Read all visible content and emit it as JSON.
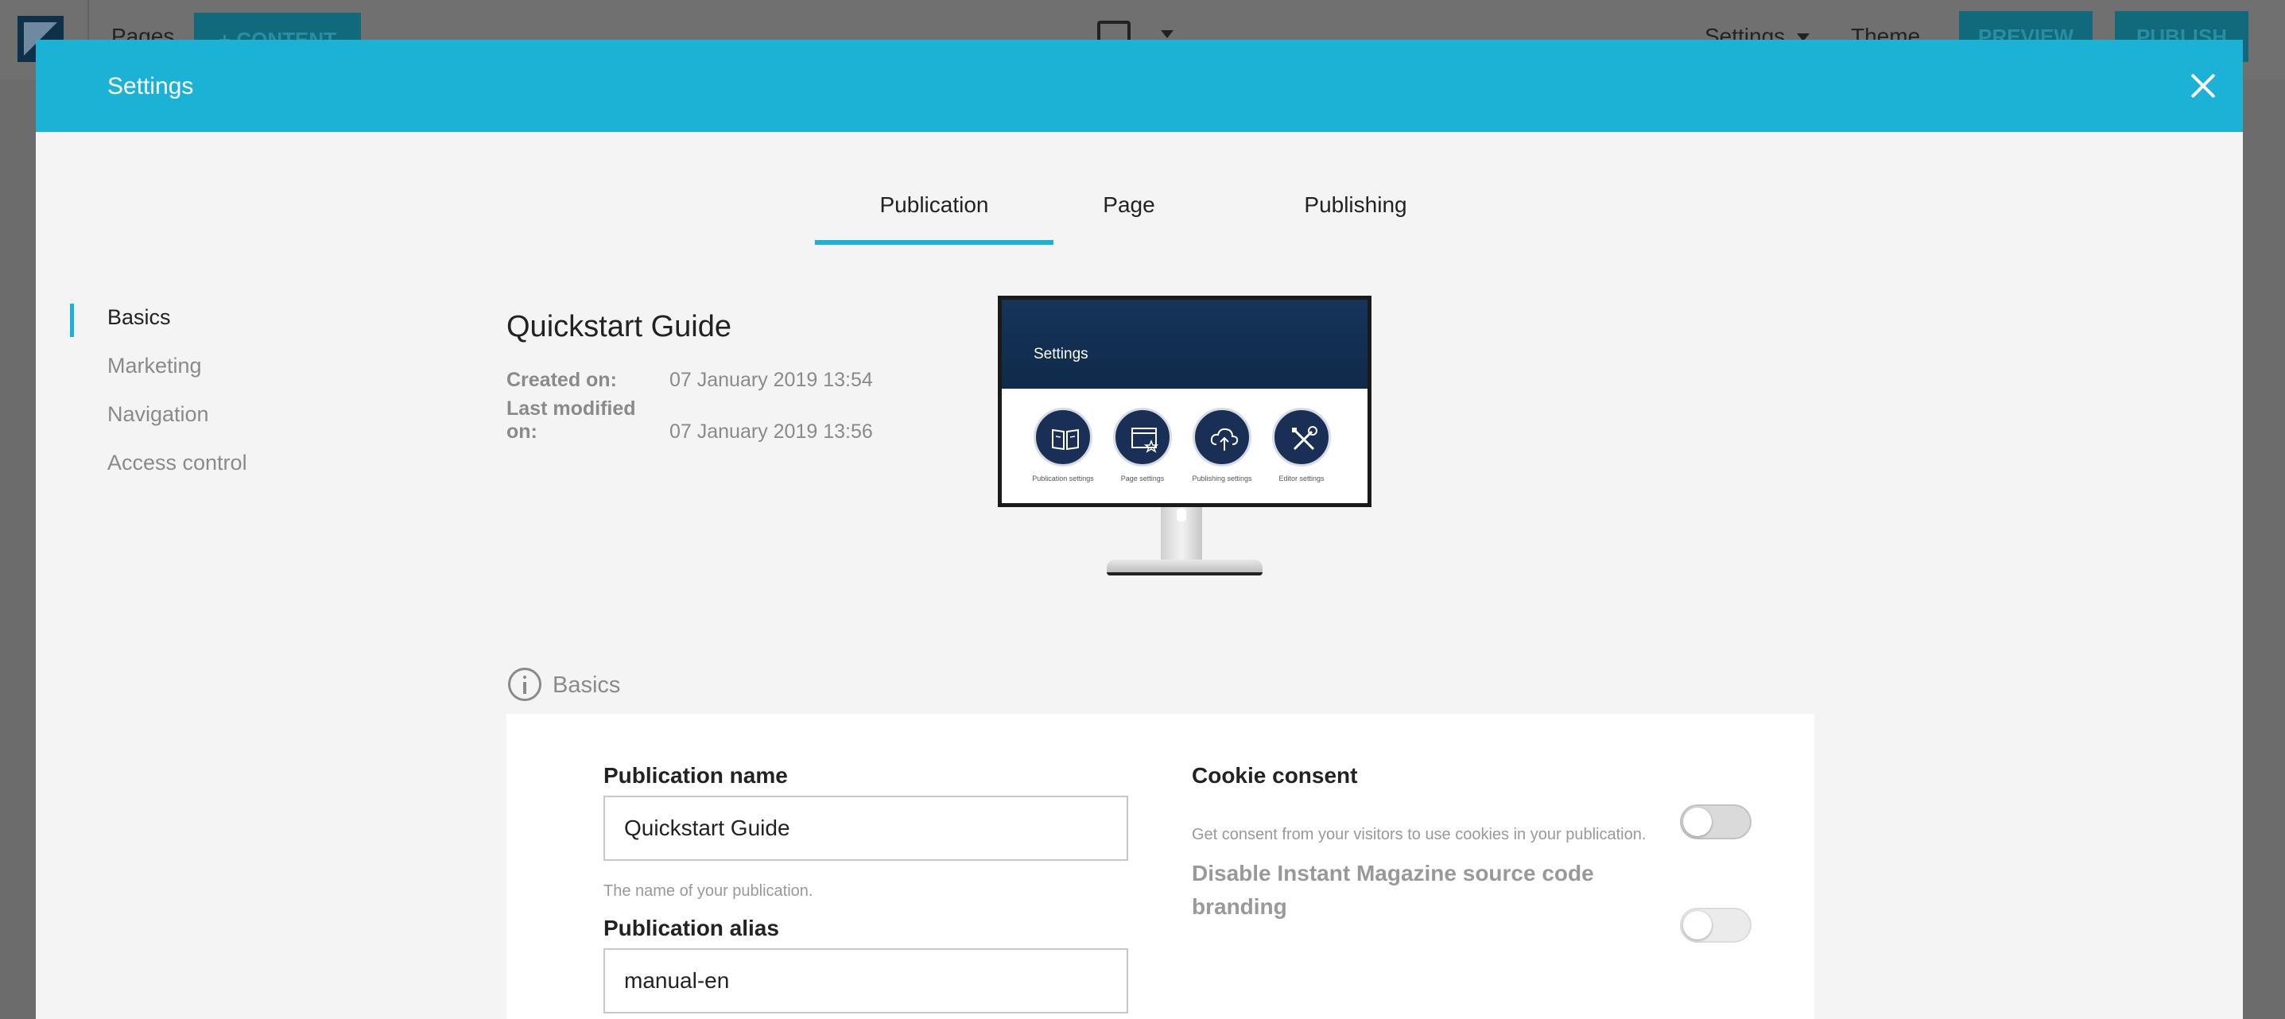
{
  "app": {
    "pages_label": "Pages",
    "content_button": "+ CONTENT",
    "settings_menu": "Settings",
    "theme_label": "Theme",
    "preview_button": "PREVIEW",
    "publish_button": "PUBLISH"
  },
  "modal": {
    "title": "Settings",
    "tabs": [
      {
        "label": "Publication",
        "active": true
      },
      {
        "label": "Page",
        "active": false
      },
      {
        "label": "Publishing",
        "active": false
      }
    ],
    "sidebar": [
      {
        "label": "Basics",
        "active": true
      },
      {
        "label": "Marketing",
        "active": false
      },
      {
        "label": "Navigation",
        "active": false
      },
      {
        "label": "Access control",
        "active": false
      }
    ],
    "publication": {
      "name": "Quickstart Guide",
      "created_label": "Created on:",
      "created_value": "07 January 2019 13:54",
      "modified_label": "Last modified on:",
      "modified_value": "07 January 2019 13:56"
    },
    "illustration": {
      "screen_title": "Settings",
      "items": [
        {
          "caption": "Publication settings",
          "icon": "book-icon"
        },
        {
          "caption": "Page settings",
          "icon": "page-star-icon"
        },
        {
          "caption": "Publishing settings",
          "icon": "cloud-upload-icon"
        },
        {
          "caption": "Editor settings",
          "icon": "tools-icon"
        }
      ]
    },
    "section": {
      "title": "Basics",
      "icon": "info-icon"
    },
    "form": {
      "publication_name_label": "Publication name",
      "publication_name_value": "Quickstart Guide",
      "publication_name_help": "The name of your publication.",
      "publication_alias_label": "Publication alias",
      "publication_alias_value": "manual-en",
      "cookie_consent_label": "Cookie consent",
      "cookie_consent_on": false,
      "cookie_consent_help": "Get consent from your visitors to use cookies in your publication.",
      "branding_label": "Disable Instant Magazine source code branding",
      "branding_on": false
    },
    "colors": {
      "accent": "#1bb2d5",
      "overlay": "#6c6c6c"
    }
  }
}
